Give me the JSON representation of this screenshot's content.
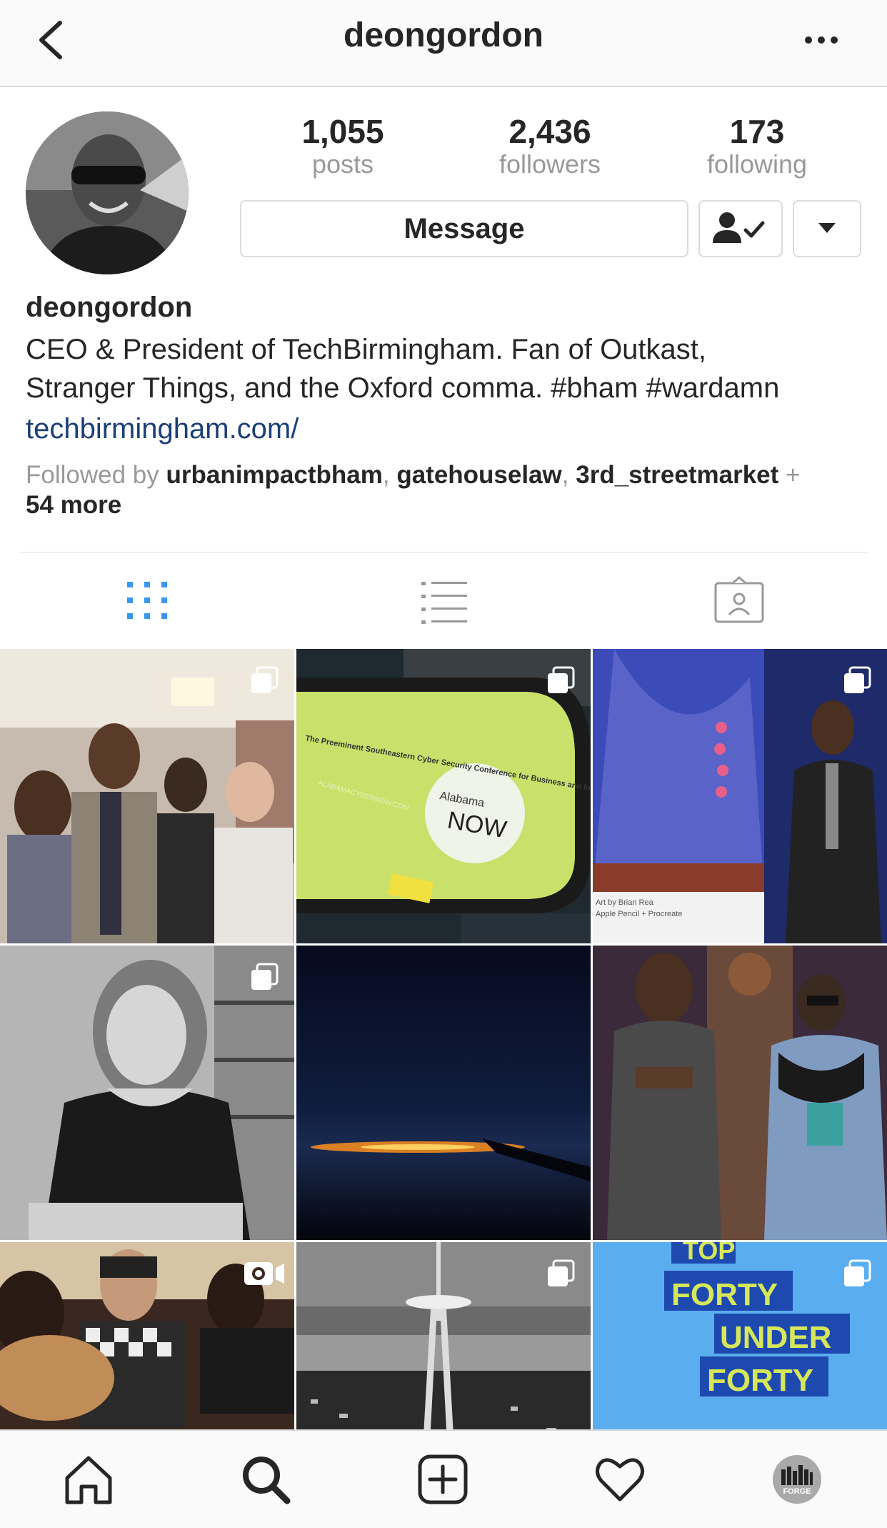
{
  "header": {
    "title": "deongordon"
  },
  "profile": {
    "stats": [
      {
        "value": "1,055",
        "label": "posts"
      },
      {
        "value": "2,436",
        "label": "followers"
      },
      {
        "value": "173",
        "label": "following"
      }
    ],
    "message_label": "Message",
    "name": "deongordon",
    "bio_line1": "CEO & President of TechBirmingham. Fan of Outkast,",
    "bio_line2": "Stranger Things, and the Oxford comma. #bham #wardamn",
    "link": "techbirmingham.com/",
    "followed_by_prefix": "Followed by ",
    "followed_by_users": [
      "urbanimpactbham",
      "gatehouselaw",
      "3rd_streetmarket"
    ],
    "followed_by_suffix": " + ",
    "followed_by_more": "54 more"
  },
  "tabs": [
    {
      "icon": "grid-icon",
      "active": true
    },
    {
      "icon": "list-icon",
      "active": false
    },
    {
      "icon": "tagged-icon",
      "active": false
    }
  ],
  "posts": {
    "card_text": {
      "conference": "The Preeminent Southeastern Cyber Security Conference for Business and Industry",
      "alabama": "Alabama",
      "now": "NOW",
      "url": "ALABAMACYBERNOW.COM",
      "artist_credit_1": "Art by Brian Rea",
      "artist_credit_2": "Apple Pencil + Procreate",
      "top": "TOP",
      "forty": "FORTY",
      "under": "UNDER",
      "forty2": "FORTY"
    }
  },
  "navbar": {
    "items": [
      "home-icon",
      "search-icon",
      "add-post-icon",
      "activity-heart-icon",
      "profile-avatar-icon"
    ],
    "avatar_text": "FORGE"
  },
  "colors": {
    "link": "#1b3f77",
    "active_tab": "#3897f0",
    "secondary_text": "#999999",
    "border": "#dbdbdb"
  }
}
